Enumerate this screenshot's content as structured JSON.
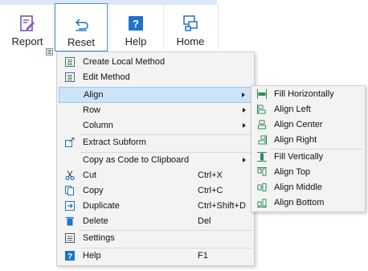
{
  "ribbon": {
    "buttons": [
      {
        "label": "Report",
        "icon": "report-icon"
      },
      {
        "label": "Reset",
        "icon": "reset-icon"
      },
      {
        "label": "Help",
        "icon": "help-icon"
      },
      {
        "label": "Home",
        "icon": "home-icon"
      }
    ]
  },
  "menu": {
    "create_local_method": "Create Local Method",
    "edit_method": "Edit Method",
    "align": "Align",
    "row": "Row",
    "column": "Column",
    "extract_subform": "Extract Subform",
    "copy_as_code": "Copy as Code to Clipboard",
    "cut": "Cut",
    "cut_shortcut": "Ctrl+X",
    "copy": "Copy",
    "copy_shortcut": "Ctrl+C",
    "duplicate": "Duplicate",
    "duplicate_shortcut": "Ctrl+Shift+D",
    "delete": "Delete",
    "delete_shortcut": "Del",
    "settings": "Settings",
    "help": "Help",
    "help_shortcut": "F1"
  },
  "align_submenu": {
    "fill_horizontally": "Fill Horizontally",
    "align_left": "Align Left",
    "align_center": "Align Center",
    "align_right": "Align Right",
    "fill_vertically": "Fill Vertically",
    "align_top": "Align Top",
    "align_middle": "Align Middle",
    "align_bottom": "Align Bottom"
  },
  "colors": {
    "highlight": "#cce4f7",
    "accent": "#1e74c9",
    "align_icon": "#2e8b57"
  }
}
